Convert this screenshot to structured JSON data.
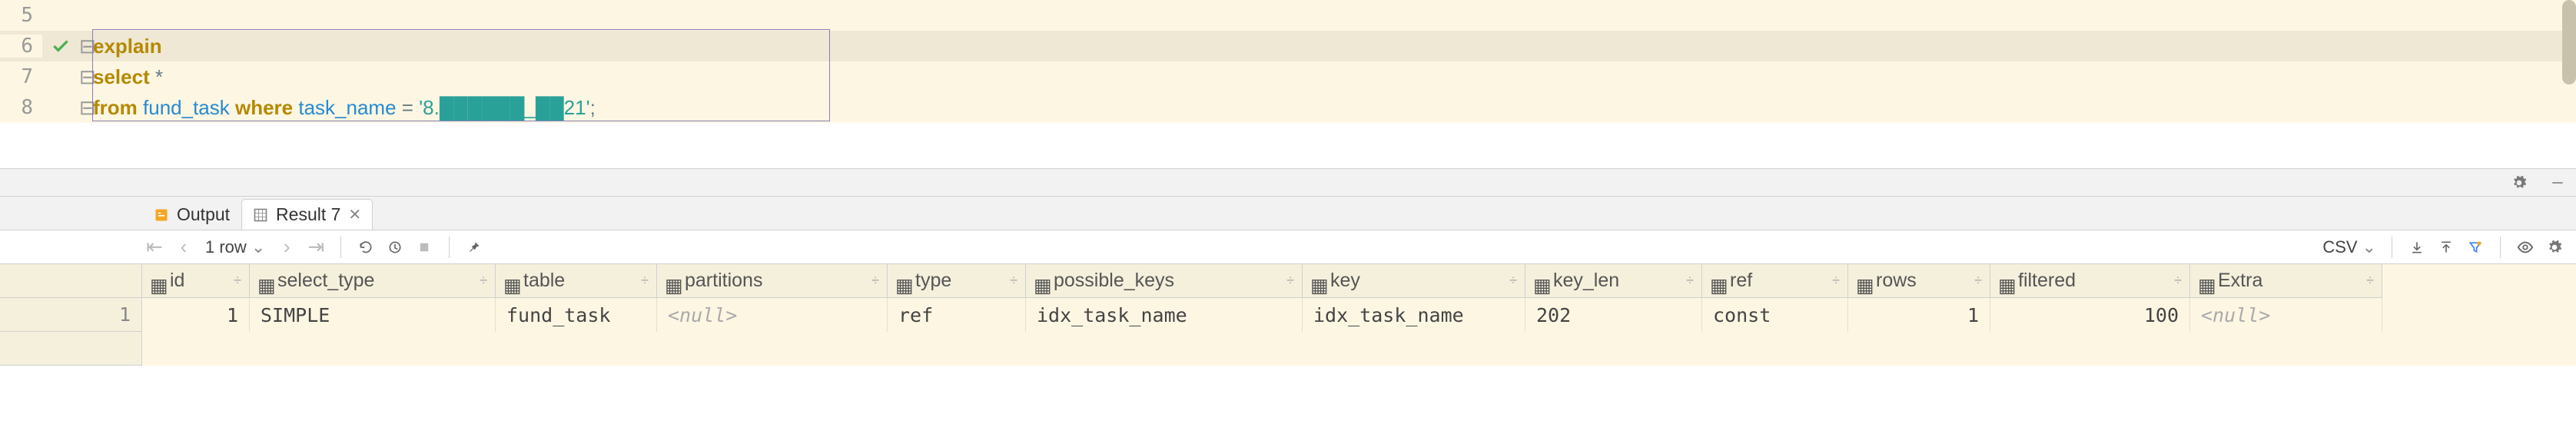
{
  "editor": {
    "lines": [
      {
        "num": "5"
      },
      {
        "num": "6"
      },
      {
        "num": "7"
      },
      {
        "num": "8"
      }
    ],
    "code6_kw": "explain",
    "code7_kw": "select",
    "code7_rest": " *",
    "code8_kw": "from",
    "code8_tbl": " fund_task ",
    "code8_where": "where",
    "code8_col": " task_name ",
    "code8_eq": "= ",
    "code8_str": "'8.██████_██21'",
    "code8_end": ";"
  },
  "tabs": {
    "output": "Output",
    "result": "Result 7"
  },
  "toolbar": {
    "rowcount": "1 row",
    "export_label": "CSV"
  },
  "grid": {
    "headers": {
      "id": "id",
      "select_type": "select_type",
      "table": "table",
      "partitions": "partitions",
      "type": "type",
      "possible_keys": "possible_keys",
      "key": "key",
      "key_len": "key_len",
      "ref": "ref",
      "rows": "rows",
      "filtered": "filtered",
      "extra": "Extra"
    },
    "row": {
      "num": "1",
      "id": "1",
      "select_type": "SIMPLE",
      "table": "fund_task",
      "partitions": "<null>",
      "type": "ref",
      "possible_keys": "idx_task_name",
      "key": "idx_task_name",
      "key_len": "202",
      "ref": "const",
      "rows": "1",
      "filtered": "100",
      "extra": "<null>"
    }
  }
}
